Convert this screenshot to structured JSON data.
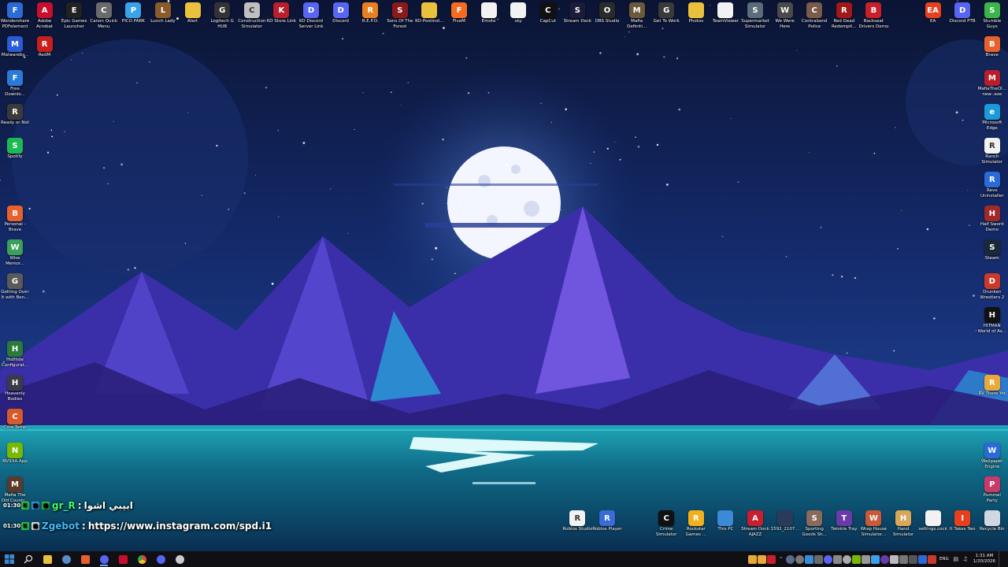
{
  "desktop": {
    "icons": [
      {
        "label": "Wondershare PDFelement",
        "color": "#2a6bd8",
        "glyph": "F",
        "col": 0,
        "row": 0,
        "side": "top"
      },
      {
        "label": "Adobe Acrobat",
        "color": "#c8102e",
        "glyph": "A",
        "col": 1,
        "row": 0,
        "side": "top"
      },
      {
        "label": "Epic Games Launcher",
        "color": "#222222",
        "glyph": "E",
        "col": 2,
        "row": 0,
        "side": "top"
      },
      {
        "label": "Canon Quick Menu",
        "color": "#6b6b6b",
        "glyph": "C",
        "col": 3,
        "row": 0,
        "side": "top"
      },
      {
        "label": "PICO PARK",
        "color": "#3aa2e8",
        "glyph": "P",
        "col": 4,
        "row": 0,
        "side": "top"
      },
      {
        "label": "Lunch Lady",
        "color": "#8a5a2b",
        "glyph": "L",
        "col": 5,
        "row": 0,
        "side": "top"
      },
      {
        "label": "Alert",
        "color": "#e9c13d",
        "glyph": "",
        "col": 6,
        "row": 0,
        "side": "top"
      },
      {
        "label": "Logitech G HUB",
        "color": "#333333",
        "glyph": "G",
        "col": 7,
        "row": 0,
        "side": "top"
      },
      {
        "label": "Construction Simulator",
        "color": "#bfbfbf",
        "glyph": "C",
        "col": 8,
        "row": 0,
        "side": "top"
      },
      {
        "label": "KO Store Link",
        "color": "#b81e2b",
        "glyph": "K",
        "col": 9,
        "row": 0,
        "side": "top"
      },
      {
        "label": "KO Discord Server Link",
        "color": "#5865f2",
        "glyph": "D",
        "col": 10,
        "row": 0,
        "side": "top"
      },
      {
        "label": "Discord",
        "color": "#5865f2",
        "glyph": "D",
        "col": 11,
        "row": 0,
        "side": "top"
      },
      {
        "label": "R.E.P.O.",
        "color": "#e8801f",
        "glyph": "R",
        "col": 12,
        "row": 0,
        "side": "top"
      },
      {
        "label": "Sons Of The Forest",
        "color": "#8b1a1a",
        "glyph": "S",
        "col": 13,
        "row": 0,
        "side": "top"
      },
      {
        "label": "KO-Postinst...",
        "color": "#e9c13d",
        "glyph": "",
        "col": 14,
        "row": 0,
        "side": "top"
      },
      {
        "label": "FiveM",
        "color": "#f36c21",
        "glyph": "F",
        "col": 15,
        "row": 0,
        "side": "top"
      },
      {
        "label": "Emote",
        "color": "#f2f2f2",
        "glyph": "",
        "col": 16,
        "row": 0,
        "side": "top"
      },
      {
        "label": "sky",
        "color": "#f2f2f2",
        "glyph": "",
        "col": 17,
        "row": 0,
        "side": "top"
      },
      {
        "label": "CapCut",
        "color": "#111111",
        "glyph": "C",
        "col": 18,
        "row": 0,
        "side": "top"
      },
      {
        "label": "Stream Deck",
        "color": "#1b1b3a",
        "glyph": "S",
        "col": 19,
        "row": 0,
        "side": "top"
      },
      {
        "label": "OBS Studio",
        "color": "#2b2b2b",
        "glyph": "O",
        "col": 20,
        "row": 0,
        "side": "top"
      },
      {
        "label": "Mafia Definiti...",
        "color": "#6b5a3a",
        "glyph": "M",
        "col": 21,
        "row": 0,
        "side": "top"
      },
      {
        "label": "Get To Work",
        "color": "#3a3a3a",
        "glyph": "G",
        "col": 22,
        "row": 0,
        "side": "top"
      },
      {
        "label": "Photos",
        "color": "#e9c13d",
        "glyph": "",
        "col": 23,
        "row": 0,
        "side": "top"
      },
      {
        "label": "TeamViewer",
        "color": "#f2f2f2",
        "glyph": "",
        "col": 24,
        "row": 0,
        "side": "top"
      },
      {
        "label": "Supermarket Simulator",
        "color": "#5a6b7a",
        "glyph": "S",
        "col": 25,
        "row": 0,
        "side": "top"
      },
      {
        "label": "We Were Here",
        "color": "#4a4a4a",
        "glyph": "W",
        "col": 26,
        "row": 0,
        "side": "top"
      },
      {
        "label": "Contraband Police",
        "color": "#7a5a4a",
        "glyph": "C",
        "col": 27,
        "row": 0,
        "side": "top"
      },
      {
        "label": "Red Dead Redempti...",
        "color": "#a01818",
        "glyph": "R",
        "col": 28,
        "row": 0,
        "side": "top"
      },
      {
        "label": "Backseat Drivers Demo",
        "color": "#c8202a",
        "glyph": "B",
        "col": 29,
        "row": 0,
        "side": "top"
      },
      {
        "label": "EA",
        "color": "#e8401f",
        "glyph": "EA",
        "col": 31,
        "row": 0,
        "side": "top"
      },
      {
        "label": "Discord PTB",
        "color": "#5865f2",
        "glyph": "D",
        "col": 32,
        "row": 0,
        "side": "top"
      },
      {
        "label": "Stumble Guys",
        "color": "#3ab54a",
        "glyph": "S",
        "col": 33,
        "row": 0,
        "side": "top"
      },
      {
        "label": "Malwareby...",
        "color": "#2a5bd8",
        "glyph": "M",
        "col": 0,
        "row": 1,
        "side": "top"
      },
      {
        "label": "RedM",
        "color": "#c81e1e",
        "glyph": "R",
        "col": 1,
        "row": 1,
        "side": "top"
      },
      {
        "label": "Free Downlo...",
        "color": "#2a7bd8",
        "glyph": "F",
        "col": 0,
        "row": 2,
        "side": "top"
      },
      {
        "label": "Ready or Not",
        "color": "#3a3a3a",
        "glyph": "R",
        "col": 0,
        "row": 3,
        "side": "top"
      },
      {
        "label": "Spotify",
        "color": "#1db954",
        "glyph": "S",
        "col": 0,
        "row": 4,
        "side": "top"
      },
      {
        "label": "Personal - Brave",
        "color": "#e8612c",
        "glyph": "B",
        "col": 0,
        "row": 6,
        "side": "top"
      },
      {
        "label": "Wise Memor...",
        "color": "#3aa05a",
        "glyph": "W",
        "col": 0,
        "row": 7,
        "side": "top"
      },
      {
        "label": "Getting Over It with Ben...",
        "color": "#5a5a5a",
        "glyph": "G",
        "col": 0,
        "row": 8,
        "side": "top"
      },
      {
        "label": "HidHide Configurat...",
        "color": "#2a7b3a",
        "glyph": "H",
        "col": 0,
        "row": 10,
        "side": "top"
      },
      {
        "label": "Heavenly Bodies",
        "color": "#3a3a4a",
        "glyph": "H",
        "col": 0,
        "row": 11,
        "side": "top"
      },
      {
        "label": "Core Temp",
        "color": "#d85a2a",
        "glyph": "C",
        "col": 0,
        "row": 12,
        "side": "top"
      },
      {
        "label": "NVIDIA App",
        "color": "#76b900",
        "glyph": "N",
        "col": 0,
        "row": 13,
        "side": "top"
      },
      {
        "label": "Mafia The Old Countr...",
        "color": "#5a3a2a",
        "glyph": "M",
        "col": 0,
        "row": 14,
        "side": "top"
      },
      {
        "label": "Brave",
        "color": "#e8612c",
        "glyph": "B",
        "col": 33,
        "row": 1,
        "side": "top"
      },
      {
        "label": "MafiaTheOl... new-.exe",
        "color": "#b81e2b",
        "glyph": "M",
        "col": 33,
        "row": 2,
        "side": "top"
      },
      {
        "label": "Microsoft Edge",
        "color": "#1b9ad8",
        "glyph": "e",
        "col": 33,
        "row": 3,
        "side": "top"
      },
      {
        "label": "Ranch Simulator",
        "color": "#f2f2f2",
        "glyph": "R",
        "col": 33,
        "row": 4,
        "side": "top"
      },
      {
        "label": "Revo Uninstaller",
        "color": "#2a6bd8",
        "glyph": "R",
        "col": 33,
        "row": 5,
        "side": "top"
      },
      {
        "label": "Half Sword Demo",
        "color": "#a02a2a",
        "glyph": "H",
        "col": 33,
        "row": 6,
        "side": "top"
      },
      {
        "label": "Steam",
        "color": "#1b2838",
        "glyph": "S",
        "col": 33,
        "row": 7,
        "side": "top"
      },
      {
        "label": "Drunken Wrestlers 2",
        "color": "#c83a2a",
        "glyph": "D",
        "col": 33,
        "row": 8,
        "side": "top"
      },
      {
        "label": "HITMAN World of As...",
        "color": "#111111",
        "glyph": "H",
        "col": 33,
        "row": 9,
        "side": "top"
      },
      {
        "label": "RV There Yet",
        "color": "#e8a83a",
        "glyph": "R",
        "col": 33,
        "row": 11,
        "side": "top"
      },
      {
        "label": "Wallpaper Engine",
        "color": "#2a6bd8",
        "glyph": "W",
        "col": 33,
        "row": 13,
        "side": "top"
      },
      {
        "label": "Pummel Party",
        "color": "#c83a6a",
        "glyph": "P",
        "col": 33,
        "row": 14,
        "side": "top"
      },
      {
        "label": "Roblox Studio",
        "color": "#f2f2f2",
        "glyph": "R",
        "col": 19,
        "row": 15,
        "side": "top"
      },
      {
        "label": "Roblox Player",
        "color": "#3a6bd8",
        "glyph": "R",
        "col": 20,
        "row": 15,
        "side": "top"
      },
      {
        "label": "Crime Simulator",
        "color": "#111111",
        "glyph": "C",
        "col": 22,
        "row": 15,
        "side": "top"
      },
      {
        "label": "Rockstar Games ...",
        "color": "#f2b01e",
        "glyph": "R",
        "col": 23,
        "row": 15,
        "side": "top"
      },
      {
        "label": "This PC",
        "color": "#3a8ad8",
        "glyph": "",
        "col": 24,
        "row": 15,
        "side": "top"
      },
      {
        "label": "Stream Dock AJAZZ",
        "color": "#c81e2e",
        "glyph": "A",
        "col": 25,
        "row": 15,
        "side": "top"
      },
      {
        "label": "1592_2107...",
        "color": "#2a3a5a",
        "glyph": "",
        "col": 26,
        "row": 15,
        "side": "top"
      },
      {
        "label": "Sporting Goods Sh...",
        "color": "#8a6a5a",
        "glyph": "S",
        "col": 27,
        "row": 15,
        "side": "top"
      },
      {
        "label": "Twinkle Tray",
        "color": "#6a3aa8",
        "glyph": "T",
        "col": 28,
        "row": 15,
        "side": "top"
      },
      {
        "label": "Wrap House Simulator...",
        "color": "#c85a3a",
        "glyph": "W",
        "col": 29,
        "row": 15,
        "side": "top"
      },
      {
        "label": "Hand Simulator",
        "color": "#d8a85a",
        "glyph": "H",
        "col": 30,
        "row": 15,
        "side": "top"
      },
      {
        "label": "settings.cock",
        "color": "#f2f2f2",
        "glyph": "",
        "col": 31,
        "row": 15,
        "side": "top"
      },
      {
        "label": "It Takes Two",
        "color": "#e8401f",
        "glyph": "I",
        "col": 32,
        "row": 15,
        "side": "top"
      },
      {
        "label": "Recycle Bin",
        "color": "#cfd8e0",
        "glyph": "",
        "col": 33,
        "row": 15,
        "side": "top"
      }
    ]
  },
  "chat": {
    "lines": [
      {
        "time": "",
        "badges": [
          "#2ecc40",
          "#3aa2e8",
          "#2ecc40"
        ],
        "user": "gr_R",
        "user_color": "#3dff6a",
        "msg": "ابيبي اشوا"
      },
      {
        "time": "01:30",
        "badges": [
          "#2ecc40",
          "#f2f2f2"
        ],
        "user": "Zgebot",
        "user_color": "#3dbcff",
        "msg": "https://www.instagram.com/spd.i1"
      }
    ]
  },
  "chat_times": {
    "first": "01:30",
    "second": "01:30"
  },
  "taskbar": {
    "apps": [
      {
        "name": "start-button",
        "color": "#3a8ad8",
        "active": false
      },
      {
        "name": "search-button",
        "color": "#dddddd",
        "active": false
      },
      {
        "name": "file-explorer",
        "color": "#e9c13d",
        "active": false
      },
      {
        "name": "steam",
        "color": "#5a8ac8",
        "active": false
      },
      {
        "name": "brave",
        "color": "#e8612c",
        "active": false
      },
      {
        "name": "discord",
        "color": "#5865f2",
        "active": true
      },
      {
        "name": "adobe-acrobat",
        "color": "#c8102e",
        "active": false
      },
      {
        "name": "chrome",
        "color": "#d84a3a",
        "active": false
      },
      {
        "name": "discord-ptb",
        "color": "#5865f2",
        "active": false
      },
      {
        "name": "settings",
        "color": "#cccccc",
        "active": false
      }
    ],
    "tray_lang": "ENG",
    "clock_time": "1:31 AM",
    "clock_date": "1/20/2026"
  }
}
